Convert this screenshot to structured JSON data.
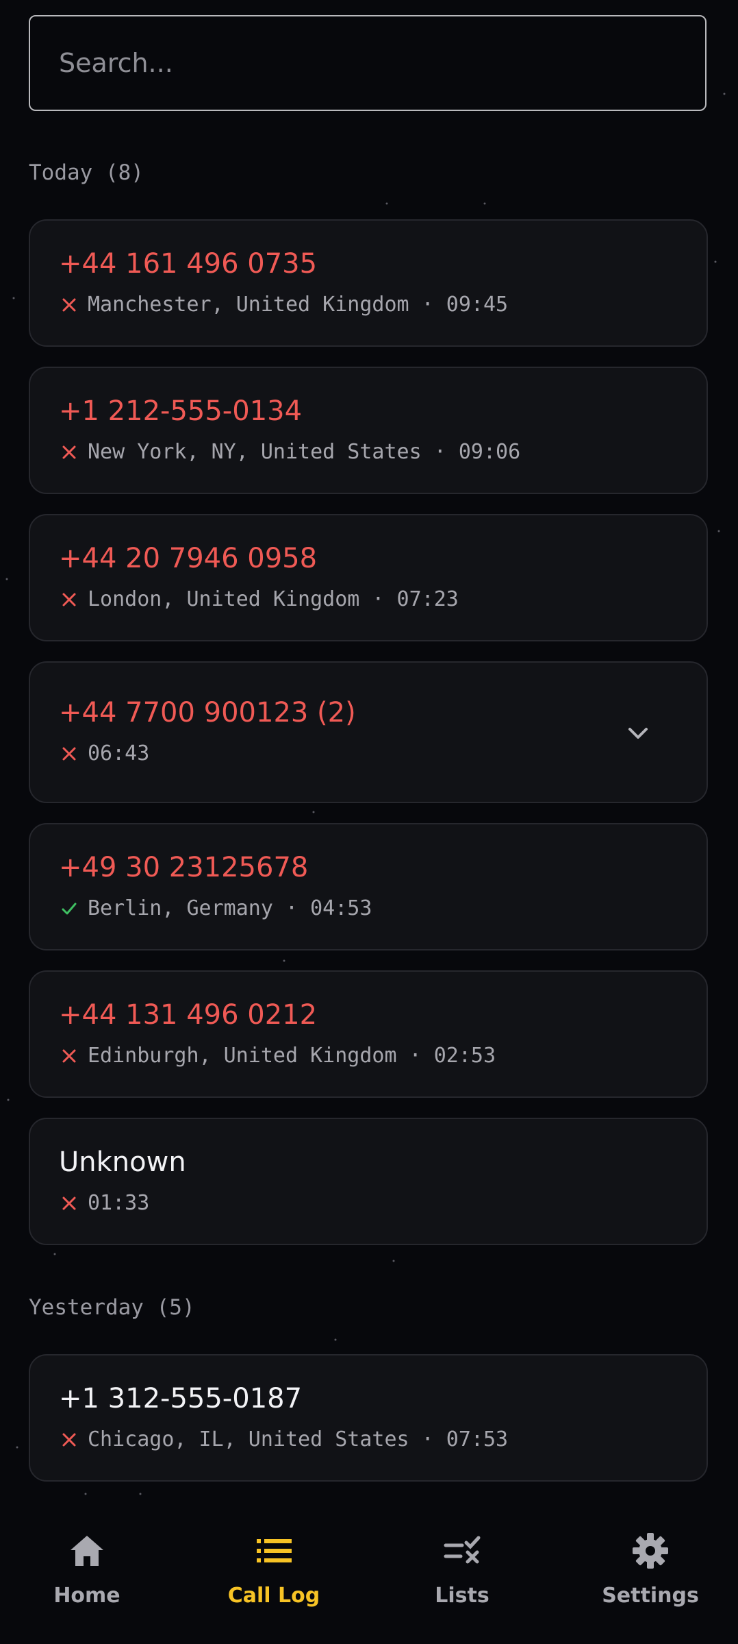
{
  "search": {
    "placeholder": "Search..."
  },
  "colors": {
    "missed": "#f05a55",
    "answered": "#3fbf62",
    "accent": "#f7c325",
    "muted": "#a6a6ad"
  },
  "sections": [
    {
      "header": "Today (8)",
      "entries": [
        {
          "number": "+44 161 496 0735",
          "status": "missed",
          "status_icon": "missed-x-icon",
          "detail": "Manchester, United Kingdom · 09:45"
        },
        {
          "number": "+1 212-555-0134",
          "status": "missed",
          "status_icon": "missed-x-icon",
          "detail": "New York, NY, United States · 09:06"
        },
        {
          "number": "+44 20 7946 0958",
          "status": "missed",
          "status_icon": "missed-x-icon",
          "detail": "London, United Kingdom · 07:23"
        },
        {
          "number": "+44 7700 900123 (2)",
          "status": "missed",
          "status_icon": "missed-x-icon",
          "detail": "06:43",
          "expand_icon": "chevron-down-icon"
        },
        {
          "number": "+49 30 23125678",
          "status": "answered",
          "status_icon": "answered-check-icon",
          "detail": "Berlin, Germany · 04:53"
        },
        {
          "number": "+44 131 496 0212",
          "status": "missed",
          "status_icon": "missed-x-icon",
          "detail": "Edinburgh, United Kingdom · 02:53"
        },
        {
          "number": "Unknown",
          "status": "missed",
          "status_icon": "missed-x-icon",
          "detail": "01:33"
        }
      ]
    },
    {
      "header": "Yesterday (5)",
      "entries": [
        {
          "number": "+1 312-555-0187",
          "status": "missed",
          "status_icon": "missed-x-icon",
          "detail": "Chicago, IL, United States · 07:53"
        }
      ]
    }
  ],
  "nav": [
    {
      "label": "Home",
      "icon": "home-icon",
      "active": false
    },
    {
      "label": "Call Log",
      "icon": "list-icon",
      "active": true
    },
    {
      "label": "Lists",
      "icon": "checklist-icon",
      "active": false
    },
    {
      "label": "Settings",
      "icon": "gear-icon",
      "active": false
    }
  ]
}
